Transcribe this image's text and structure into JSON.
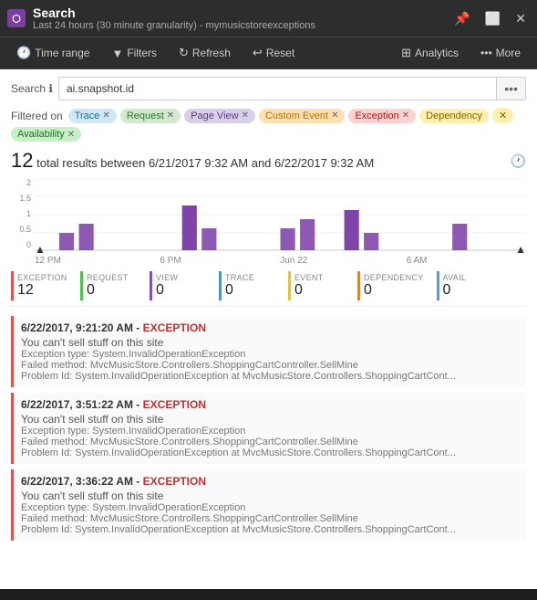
{
  "titleBar": {
    "appIcon": "⬡",
    "title": "Search",
    "subtitle": "Last 24 hours (30 minute granularity) - mymusicstoreexceptions"
  },
  "toolbar": {
    "timeRange": "Time range",
    "filters": "Filters",
    "refresh": "Refresh",
    "reset": "Reset",
    "analytics": "Analytics",
    "more": "More"
  },
  "search": {
    "label": "Search",
    "placeholder": "ai.snapshot.id",
    "value": "ai.snapshot.id"
  },
  "filterTags": [
    {
      "label": "Trace",
      "type": "trace"
    },
    {
      "label": "Request",
      "type": "request"
    },
    {
      "label": "Page View",
      "type": "pageview"
    },
    {
      "label": "Custom Event",
      "type": "customevent"
    },
    {
      "label": "Exception",
      "type": "exception"
    },
    {
      "label": "Dependency",
      "type": "dependency"
    },
    {
      "label": "Availability",
      "type": "availability"
    }
  ],
  "filteredOnLabel": "Filtered on",
  "results": {
    "count": "12",
    "summaryText": "total results between 6/21/2017 9:32 AM and 6/22/2017 9:32 AM"
  },
  "chartLabels": {
    "left": "12 PM",
    "mid1": "6 PM",
    "mid2": "Jun 22",
    "mid3": "6 AM",
    "right": ""
  },
  "yAxisLabels": [
    "2",
    "1.5",
    "1",
    "0.5",
    "0"
  ],
  "metrics": [
    {
      "name": "EXCEPTION",
      "value": "12",
      "type": "exception"
    },
    {
      "name": "REQUEST",
      "value": "0",
      "type": "request"
    },
    {
      "name": "VIEW",
      "value": "0",
      "type": "view"
    },
    {
      "name": "TRACE",
      "value": "0",
      "type": "trace"
    },
    {
      "name": "EVENT",
      "value": "0",
      "type": "event"
    },
    {
      "name": "DEPENDENCY",
      "value": "0",
      "type": "dependency"
    },
    {
      "name": "AVAIL",
      "value": "0",
      "type": "avail"
    }
  ],
  "resultItems": [
    {
      "timestamp": "6/22/2017, 9:21:20 AM",
      "type": "EXCEPTION",
      "desc": "You can't sell stuff on this site",
      "excType": "Exception type: System.InvalidOperationException",
      "method": "Failed method: MvcMusicStore.Controllers.ShoppingCartController.SellMine",
      "problem": "Problem Id: System.InvalidOperationException at MvcMusicStore.Controllers.ShoppingCartCont..."
    },
    {
      "timestamp": "6/22/2017, 3:51:22 AM",
      "type": "EXCEPTION",
      "desc": "You can't sell stuff on this site",
      "excType": "Exception type: System.InvalidOperationException",
      "method": "Failed method: MvcMusicStore.Controllers.ShoppingCartController.SellMine",
      "problem": "Problem Id: System.InvalidOperationException at MvcMusicStore.Controllers.ShoppingCartCont..."
    },
    {
      "timestamp": "6/22/2017, 3:36:22 AM",
      "type": "EXCEPTION",
      "desc": "You can't sell stuff on this site",
      "excType": "Exception type: System.InvalidOperationException",
      "method": "Failed method: MvcMusicStore.Controllers.ShoppingCartController.SellMine",
      "problem": "Problem Id: System.InvalidOperationException at MvcMusicStore.Controllers.ShoppingCartCont..."
    }
  ]
}
